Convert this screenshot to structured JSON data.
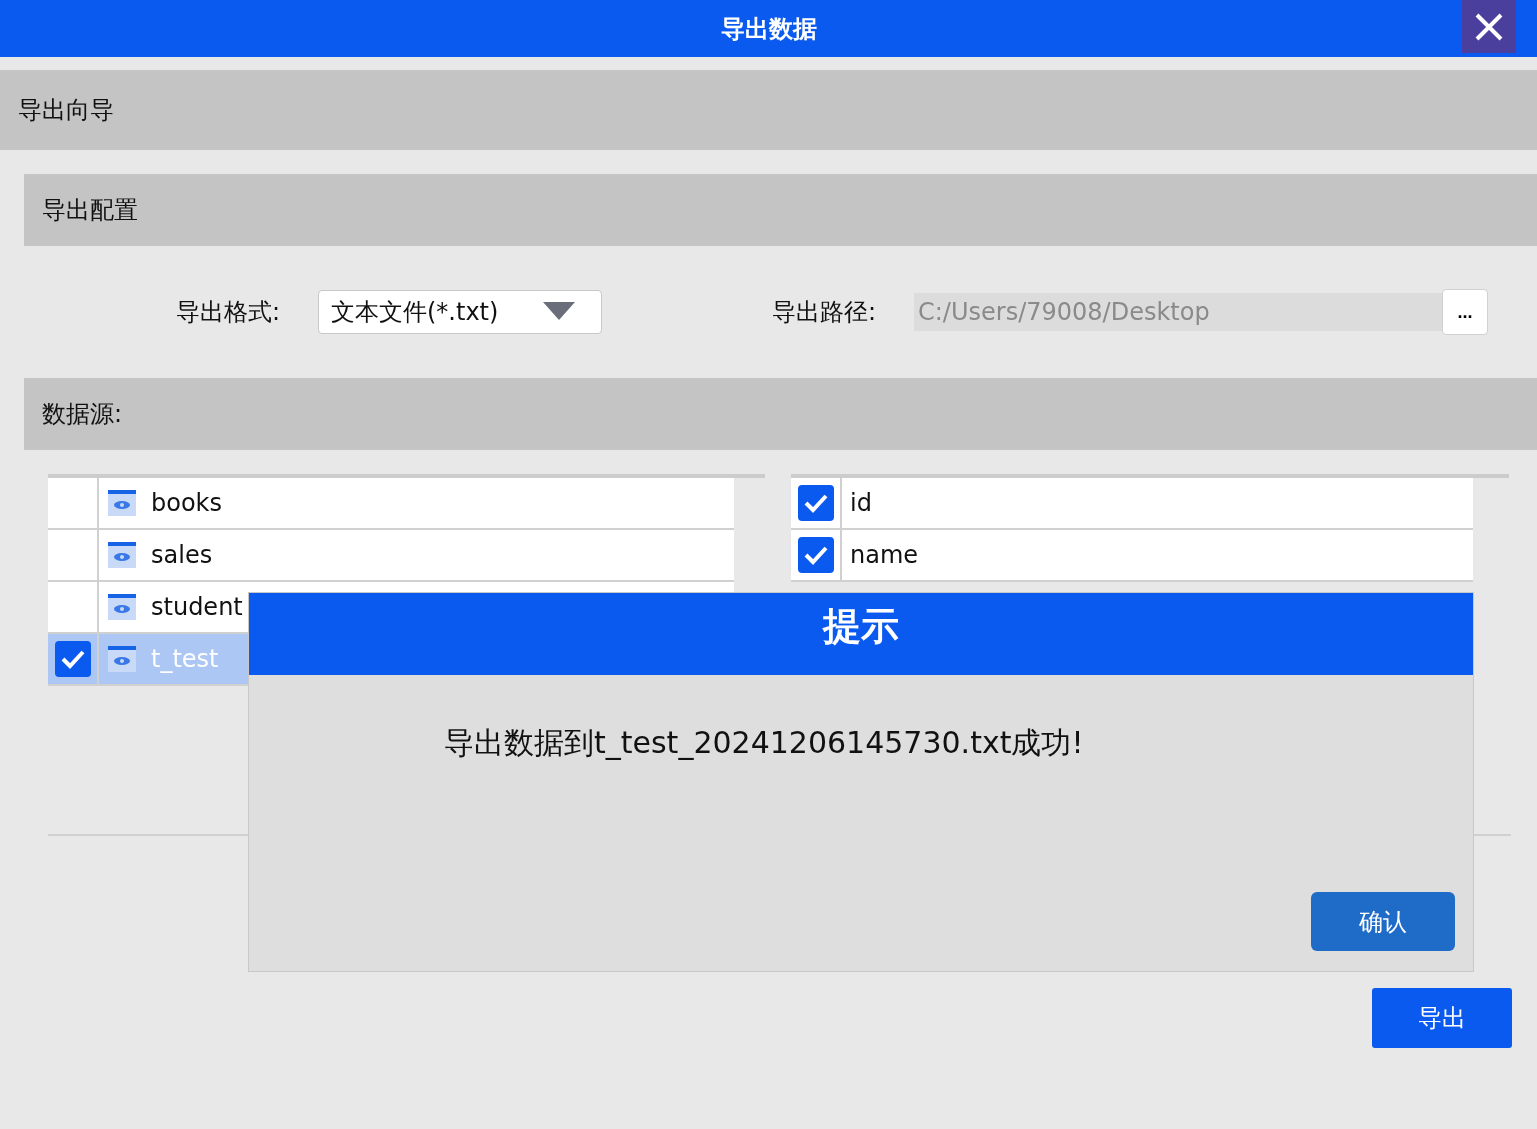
{
  "window": {
    "title": "导出数据"
  },
  "wizard": {
    "title": "导出向导"
  },
  "config": {
    "title": "导出配置",
    "format_label": "导出格式:",
    "format_value": "文本文件(*.txt)",
    "path_label": "导出路径:",
    "path_value": "C:/Users/79008/Desktop",
    "browse_button": "..."
  },
  "data_source": {
    "title": "数据源:",
    "tables": [
      {
        "name": "books",
        "checked": false,
        "selected": false
      },
      {
        "name": "sales",
        "checked": false,
        "selected": false
      },
      {
        "name": "student",
        "checked": false,
        "selected": false
      },
      {
        "name": "t_test",
        "checked": true,
        "selected": true
      }
    ],
    "fields": [
      {
        "name": "id",
        "checked": true
      },
      {
        "name": "name",
        "checked": true
      }
    ]
  },
  "export_button": "导出",
  "dialog": {
    "title": "提示",
    "message": "导出数据到t_test_20241206145730.txt成功!",
    "confirm_button": "确认"
  }
}
